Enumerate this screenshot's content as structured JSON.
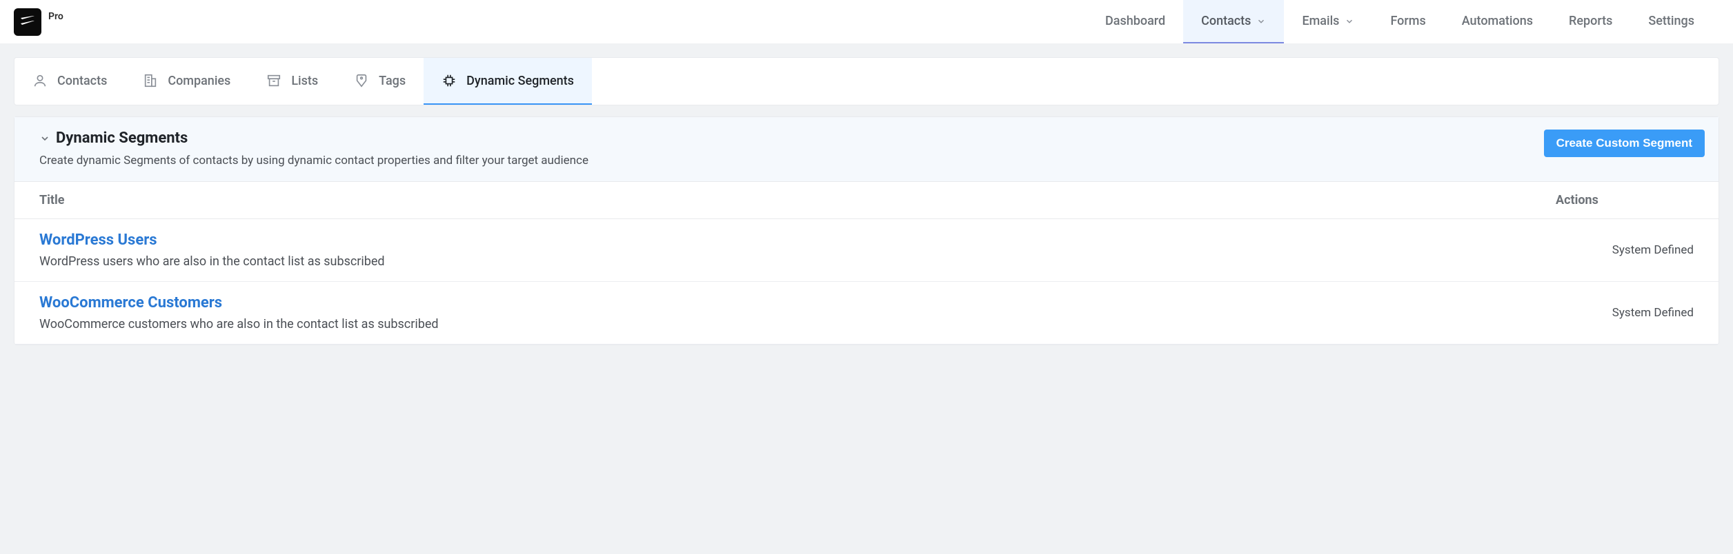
{
  "brand": {
    "label": "Pro"
  },
  "top_nav": {
    "items": [
      {
        "label": "Dashboard",
        "dropdown": false,
        "active": false
      },
      {
        "label": "Contacts",
        "dropdown": true,
        "active": true
      },
      {
        "label": "Emails",
        "dropdown": true,
        "active": false
      },
      {
        "label": "Forms",
        "dropdown": false,
        "active": false
      },
      {
        "label": "Automations",
        "dropdown": false,
        "active": false
      },
      {
        "label": "Reports",
        "dropdown": false,
        "active": false
      },
      {
        "label": "Settings",
        "dropdown": false,
        "active": false
      }
    ]
  },
  "sub_tabs": {
    "items": [
      {
        "label": "Contacts",
        "active": false
      },
      {
        "label": "Companies",
        "active": false
      },
      {
        "label": "Lists",
        "active": false
      },
      {
        "label": "Tags",
        "active": false
      },
      {
        "label": "Dynamic Segments",
        "active": true
      }
    ]
  },
  "panel": {
    "title": "Dynamic Segments",
    "description": "Create dynamic Segments of contacts by using dynamic contact properties and filter your target audience",
    "create_button": "Create Custom Segment"
  },
  "table": {
    "columns": {
      "title": "Title",
      "actions": "Actions"
    },
    "rows": [
      {
        "title": "WordPress Users",
        "description": "WordPress users who are also in the contact list as subscribed",
        "action_label": "System Defined"
      },
      {
        "title": "WooCommerce Customers",
        "description": "WooCommerce customers who are also in the contact list as subscribed",
        "action_label": "System Defined"
      }
    ]
  }
}
